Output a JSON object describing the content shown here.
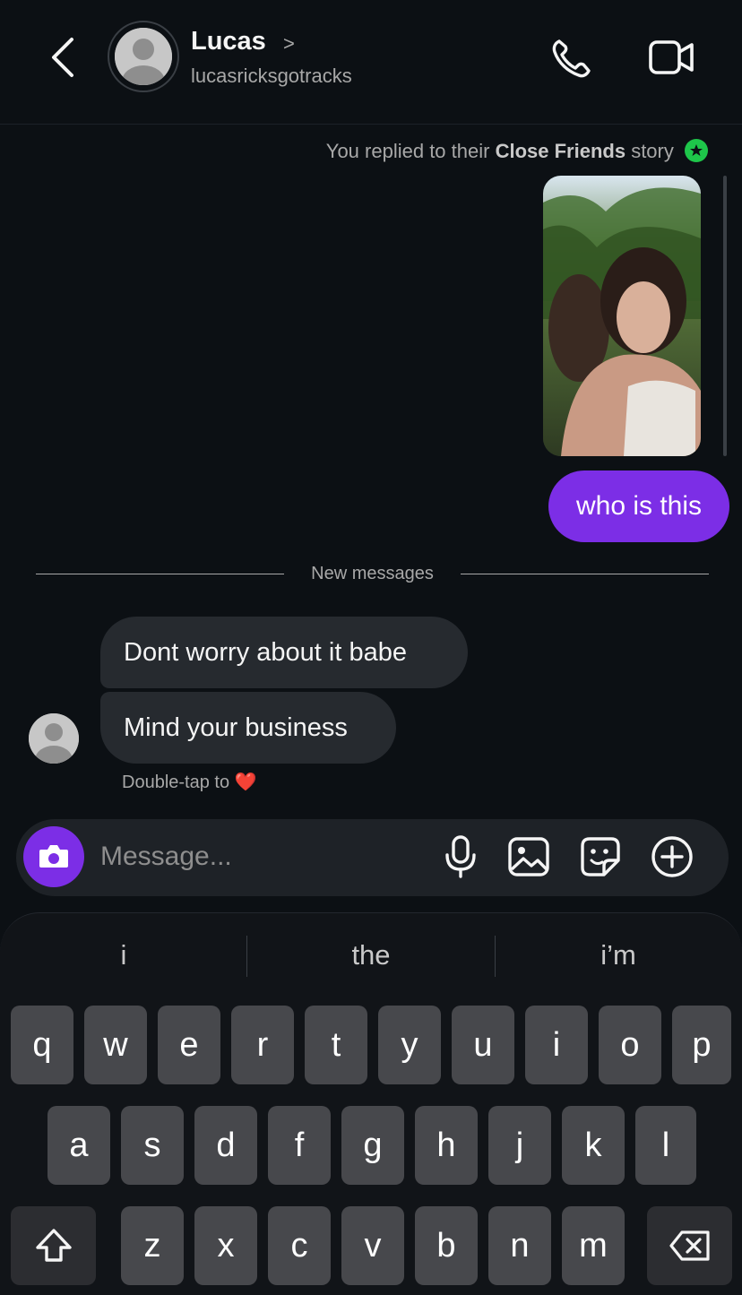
{
  "header": {
    "name": "Lucas",
    "name_chevron": ">",
    "username": "lucasricksgotracks",
    "icons": [
      "back-chevron-icon",
      "avatar-placeholder-icon",
      "phone-icon",
      "video-camera-icon"
    ]
  },
  "thread": {
    "story_note_prefix": "You replied to their",
    "story_note_bold": "Close Friends",
    "story_note_suffix": "story",
    "my_message": "who is this",
    "divider_label": "New messages",
    "incoming": [
      "Dont worry about it babe",
      "Mind your business"
    ],
    "double_tap_label": "Double-tap to",
    "double_tap_emoji": "❤️"
  },
  "composer": {
    "placeholder": "Message...",
    "icons": [
      "camera-icon",
      "microphone-icon",
      "gallery-icon",
      "sticker-icon",
      "plus-circle-icon"
    ]
  },
  "keyboard": {
    "suggestions": [
      "i",
      "the",
      "i’m"
    ],
    "row1": [
      "q",
      "w",
      "e",
      "r",
      "t",
      "y",
      "u",
      "i",
      "o",
      "p"
    ],
    "row2": [
      "a",
      "s",
      "d",
      "f",
      "g",
      "h",
      "j",
      "k",
      "l"
    ],
    "row3": [
      "z",
      "x",
      "c",
      "v",
      "b",
      "n",
      "m"
    ]
  },
  "colors": {
    "background": "#0c1014",
    "accent": "#7c2ee6",
    "incoming_bubble": "#262a2f",
    "close_friends": "#1ec64a"
  }
}
